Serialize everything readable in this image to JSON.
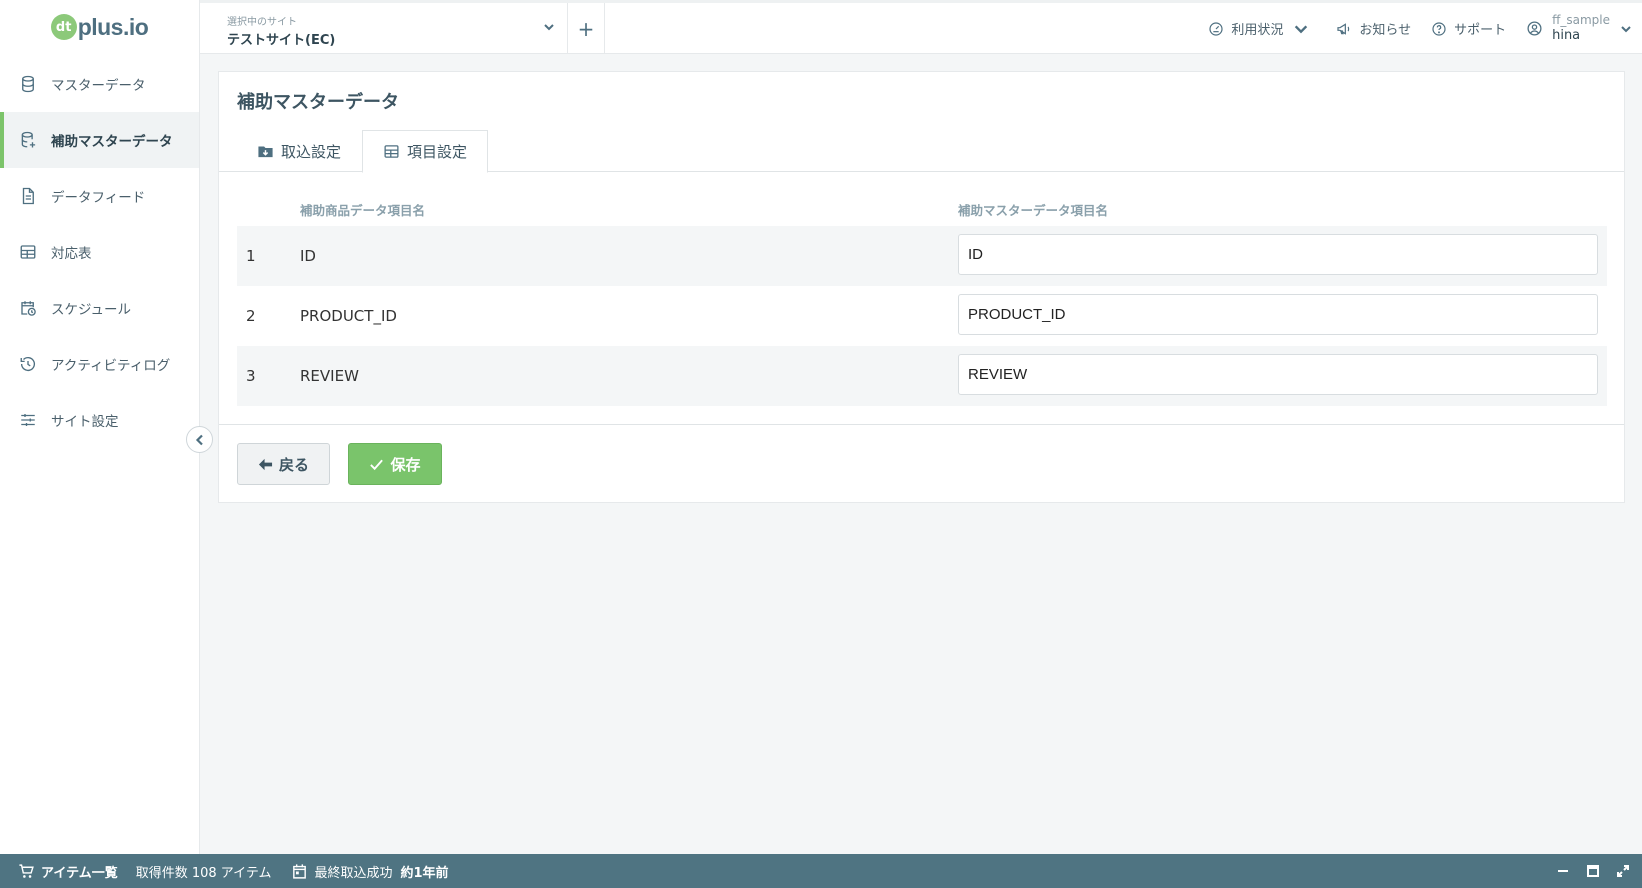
{
  "brand": {
    "logo_mark": "dt",
    "logo_text": "plus.io"
  },
  "sidebar": {
    "items": [
      {
        "label": "マスターデータ",
        "icon": "database-icon",
        "active": false
      },
      {
        "label": "補助マスターデータ",
        "icon": "database-plus-icon",
        "active": true
      },
      {
        "label": "データフィード",
        "icon": "document-icon",
        "active": false
      },
      {
        "label": "対応表",
        "icon": "table-icon",
        "active": false
      },
      {
        "label": "スケジュール",
        "icon": "calendar-clock-icon",
        "active": false
      },
      {
        "label": "アクティビティログ",
        "icon": "history-icon",
        "active": false
      },
      {
        "label": "サイト設定",
        "icon": "sliders-icon",
        "active": false
      }
    ]
  },
  "topbar": {
    "site_caption": "選択中のサイト",
    "site_name": "テストサイト(EC)",
    "add_label": "+",
    "usage_label": "利用状況",
    "news_label": "お知らせ",
    "support_label": "サポート",
    "user_id": "ff_sample",
    "user_name": "hina"
  },
  "page": {
    "title": "補助マスターデータ",
    "tabs": [
      {
        "label": "取込設定",
        "icon": "folder-download-icon",
        "active": false
      },
      {
        "label": "項目設定",
        "icon": "table-icon",
        "active": true
      }
    ],
    "table": {
      "col1_header": "補助商品データ項目名",
      "col2_header": "補助マスターデータ項目名",
      "rows": [
        {
          "num": "1",
          "name": "ID",
          "value": "ID"
        },
        {
          "num": "2",
          "name": "PRODUCT_ID",
          "value": "PRODUCT_ID"
        },
        {
          "num": "3",
          "name": "REVIEW",
          "value": "REVIEW"
        }
      ]
    },
    "back_label": "戻る",
    "save_label": "保存"
  },
  "bottombar": {
    "title": "アイテム一覧",
    "count_text": "取得件数 108 アイテム",
    "last_label": "最終取込成功",
    "last_value": "約1年前"
  },
  "colors": {
    "accent": "#7ac46b",
    "primary": "#4f7482",
    "text": "#3d5562"
  }
}
